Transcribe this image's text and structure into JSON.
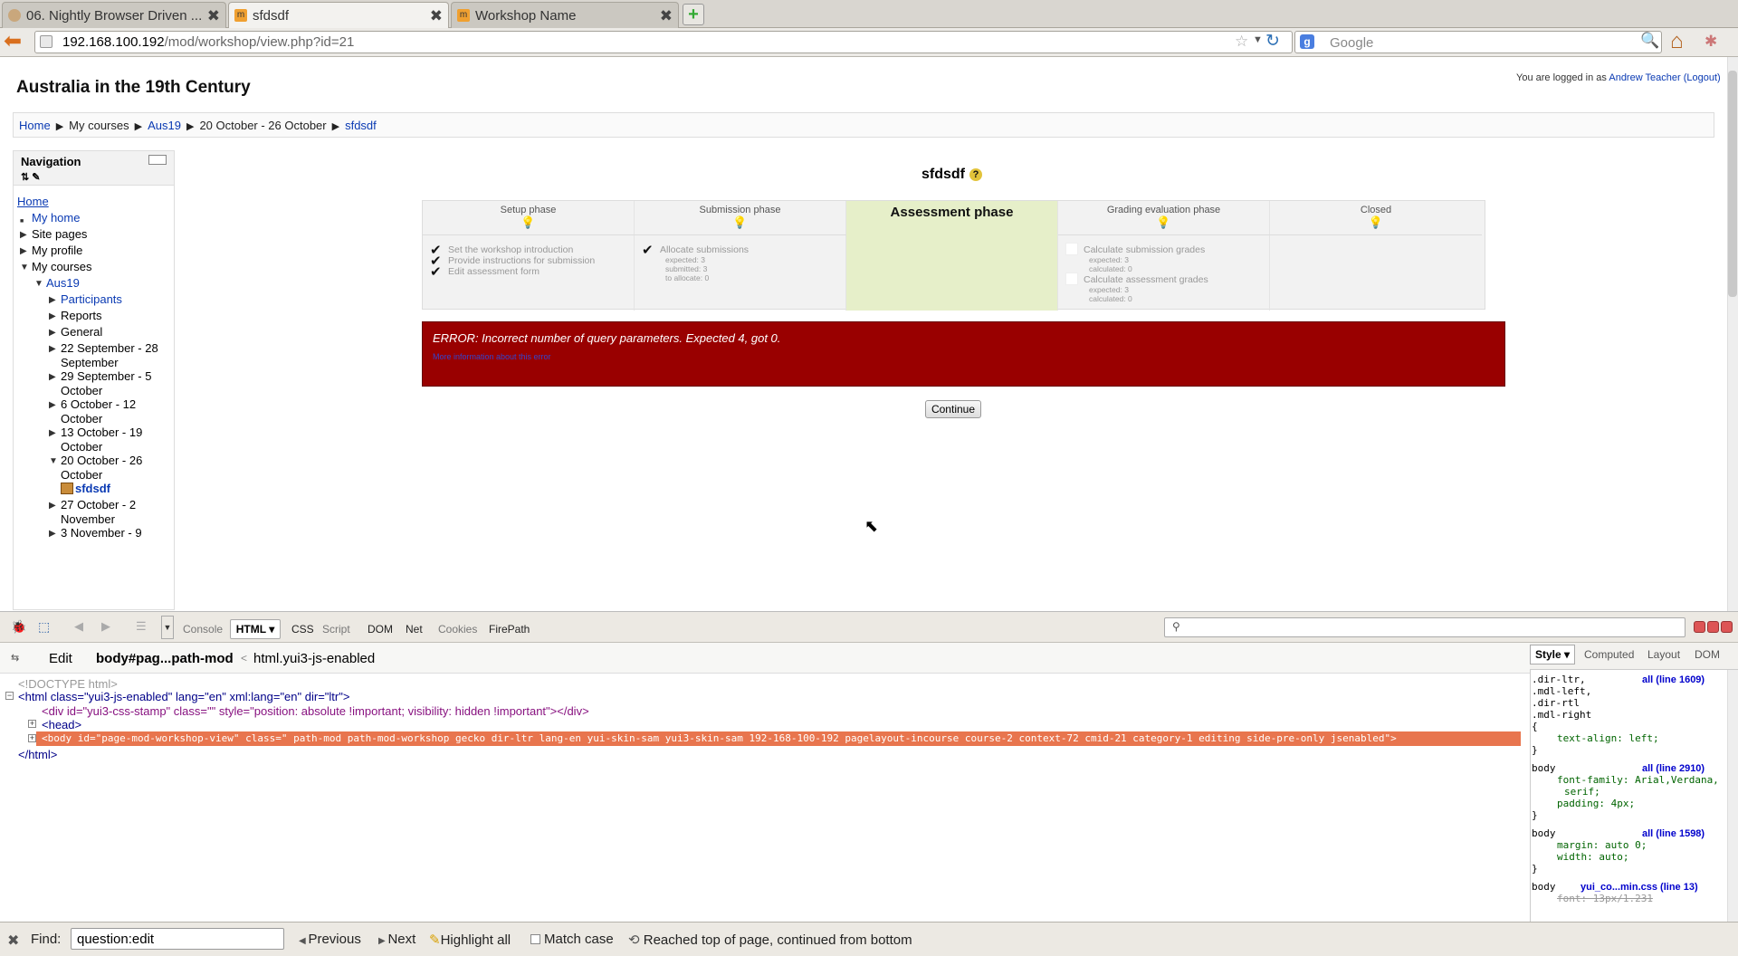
{
  "browser": {
    "tabs": [
      {
        "title": "06. Nightly Browser Driven ...",
        "active": false
      },
      {
        "title": "sfdsdf",
        "active": true
      },
      {
        "title": "Workshop Name",
        "active": false
      }
    ],
    "url_host": "192.168.100.192",
    "url_path": "/mod/workshop/view.php?id=21",
    "search_placeholder": "Google",
    "search_engine_letter": "g"
  },
  "page": {
    "site_title": "Australia in the 19th Century",
    "login_prefix": "You are logged in as",
    "login_user": "Andrew Teacher",
    "logout_label": "(Logout)",
    "breadcrumb": [
      "Home",
      "My courses",
      "Aus19",
      "20 October - 26 October",
      "sfdsdf"
    ],
    "breadcrumb_sep": "▶",
    "navigation": {
      "title": "Navigation",
      "items": [
        "Home",
        "My home",
        "Site pages",
        "My profile",
        "My courses",
        "Aus19",
        "Participants",
        "Reports",
        "General",
        "22 September - 28 September",
        "29 September - 5 October",
        "6 October - 12 October",
        "13 October - 19 October",
        "20 October - 26 October",
        "sfdsdf",
        "27 October - 2 November",
        "3 November - 9"
      ]
    },
    "workshop_title": "sfdsdf",
    "help_icon": "?",
    "phases": [
      {
        "name": "Setup phase",
        "tasks": [
          "Set the workshop introduction",
          "Provide instructions for submission",
          "Edit assessment form"
        ]
      },
      {
        "name": "Submission phase",
        "tasks": [
          "Allocate submissions"
        ],
        "details": [
          "expected: 3",
          "submitted: 3",
          "to allocate: 0"
        ]
      },
      {
        "name": "Assessment phase",
        "current": true
      },
      {
        "name": "Grading evaluation phase",
        "tasks": [
          "Calculate submission grades",
          "Calculate assessment grades"
        ],
        "details": [
          "expected: 3",
          "calculated: 0",
          "expected: 3",
          "calculated: 0"
        ]
      },
      {
        "name": "Closed"
      }
    ],
    "error_message": "ERROR: Incorrect number of query parameters. Expected 4, got 0.",
    "error_link": "More information about this error",
    "continue_label": "Continue"
  },
  "firebug": {
    "tabs": [
      "Console",
      "HTML",
      "CSS",
      "Script",
      "DOM",
      "Net",
      "Cookies",
      "FirePath"
    ],
    "edit_label": "Edit",
    "path_current": "body#pag...path-mod",
    "path_parent": "html.yui3-js-enabled",
    "path_sep": "<",
    "side_tabs": [
      "Style",
      "Computed",
      "Layout",
      "DOM"
    ],
    "html_lines": [
      "<!DOCTYPE html>",
      "<html class=\"yui3-js-enabled\" lang=\"en\" xml:lang=\"en\" dir=\"ltr\">",
      "<div id=\"yui3-css-stamp\" class=\"\" style=\"position: absolute !important; visibility: hidden !important\"></div>",
      "<head>",
      "<body id=\"page-mod-workshop-view\" class=\" path-mod path-mod-workshop gecko dir-ltr lang-en yui-skin-sam yui3-skin-sam 192-168-100-192 pagelayout-incourse course-2 context-72 cmid-21 category-1 editing side-pre-only jsenabled\">",
      "</html>"
    ],
    "css_rules": [
      {
        "selectors": [
          ".dir-ltr,",
          ".mdl-left,",
          ".dir-rtl",
          ".mdl-right"
        ],
        "source": "all (line 1609)",
        "props": [
          "text-align: left;"
        ]
      },
      {
        "selectors": [
          "body"
        ],
        "source": "all (line 2910)",
        "props": [
          "font-family: Arial,Verdana,",
          "serif;",
          "padding: 4px;"
        ]
      },
      {
        "selectors": [
          "body"
        ],
        "source": "all (line 1598)",
        "props": [
          "margin: auto 0;",
          "width: auto;"
        ]
      },
      {
        "selectors": [
          "body"
        ],
        "source": "yui_co...min.css (line 13)",
        "props": [
          "font: 13px/1.231"
        ]
      }
    ]
  },
  "findbar": {
    "label": "Find:",
    "value": "question:edit",
    "previous": "Previous",
    "next": "Next",
    "highlight": "Highlight all",
    "match_case": "Match case",
    "status": "Reached top of page, continued from bottom"
  }
}
